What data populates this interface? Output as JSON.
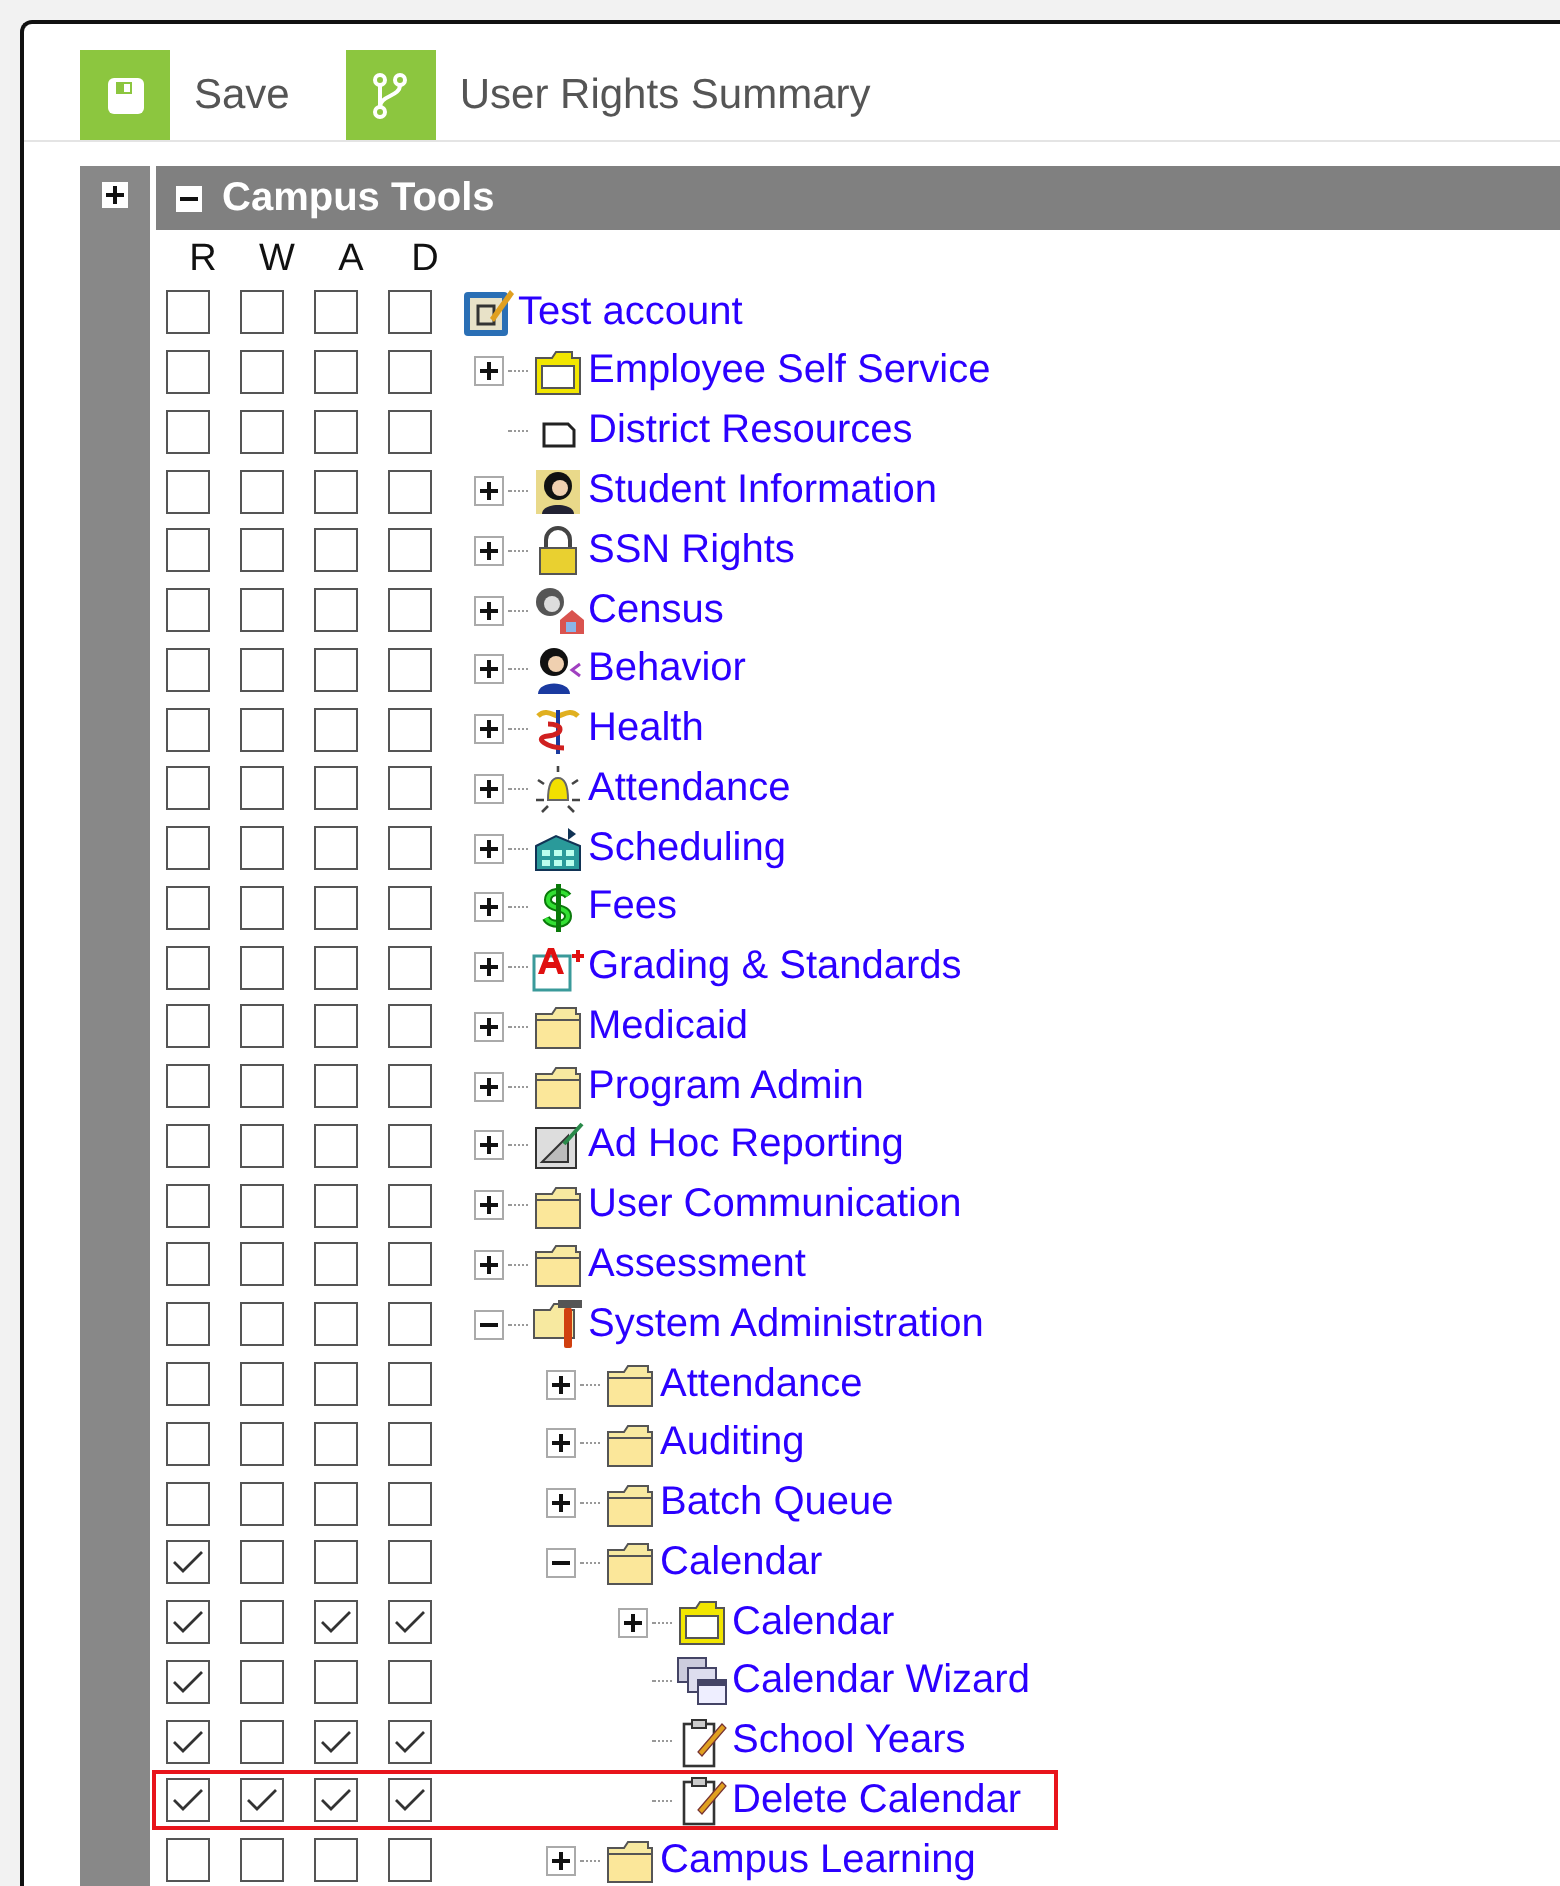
{
  "toolbar": [
    {
      "kind": "save",
      "label": "Save"
    },
    {
      "kind": "summary",
      "label": "User Rights Summary"
    }
  ],
  "sidebar": {
    "expanded": false
  },
  "section": {
    "title": "Campus Tools",
    "expanded": true
  },
  "columns": [
    "R",
    "W",
    "A",
    "D"
  ],
  "tree": {
    "label": "Test account",
    "kind": "account",
    "rights": [
      false,
      false,
      false,
      false
    ],
    "children": [
      {
        "label": "Employee Self Service",
        "kind": "folder-white",
        "rights": [
          false,
          false,
          false,
          false
        ],
        "expanded": false
      },
      {
        "label": "District Resources",
        "kind": "page",
        "rights": [
          false,
          false,
          false,
          false
        ]
      },
      {
        "label": "Student Information",
        "kind": "student",
        "rights": [
          false,
          false,
          false,
          false
        ],
        "expanded": false
      },
      {
        "label": "SSN Rights",
        "kind": "lock",
        "rights": [
          false,
          false,
          false,
          false
        ],
        "expanded": false
      },
      {
        "label": "Census",
        "kind": "census",
        "rights": [
          false,
          false,
          false,
          false
        ],
        "expanded": false
      },
      {
        "label": "Behavior",
        "kind": "behavior",
        "rights": [
          false,
          false,
          false,
          false
        ],
        "expanded": false
      },
      {
        "label": "Health",
        "kind": "health",
        "rights": [
          false,
          false,
          false,
          false
        ],
        "expanded": false
      },
      {
        "label": "Attendance",
        "kind": "bell",
        "rights": [
          false,
          false,
          false,
          false
        ],
        "expanded": false
      },
      {
        "label": "Scheduling",
        "kind": "scheduling",
        "rights": [
          false,
          false,
          false,
          false
        ],
        "expanded": false
      },
      {
        "label": "Fees",
        "kind": "fees",
        "rights": [
          false,
          false,
          false,
          false
        ],
        "expanded": false
      },
      {
        "label": "Grading & Standards",
        "kind": "grading",
        "rights": [
          false,
          false,
          false,
          false
        ],
        "expanded": false
      },
      {
        "label": "Medicaid",
        "kind": "folder",
        "rights": [
          false,
          false,
          false,
          false
        ],
        "expanded": false
      },
      {
        "label": "Program Admin",
        "kind": "folder",
        "rights": [
          false,
          false,
          false,
          false
        ],
        "expanded": false
      },
      {
        "label": "Ad Hoc Reporting",
        "kind": "report",
        "rights": [
          false,
          false,
          false,
          false
        ],
        "expanded": false
      },
      {
        "label": "User Communication",
        "kind": "folder",
        "rights": [
          false,
          false,
          false,
          false
        ],
        "expanded": false
      },
      {
        "label": "Assessment",
        "kind": "folder",
        "rights": [
          false,
          false,
          false,
          false
        ],
        "expanded": false
      },
      {
        "label": "System Administration",
        "kind": "tools",
        "rights": [
          false,
          false,
          false,
          false
        ],
        "expanded": true,
        "children": [
          {
            "label": "Attendance",
            "kind": "folder",
            "rights": [
              false,
              false,
              false,
              false
            ],
            "expanded": false
          },
          {
            "label": "Auditing",
            "kind": "folder",
            "rights": [
              false,
              false,
              false,
              false
            ],
            "expanded": false
          },
          {
            "label": "Batch Queue",
            "kind": "folder",
            "rights": [
              false,
              false,
              false,
              false
            ],
            "expanded": false
          },
          {
            "label": "Calendar",
            "kind": "folder",
            "rights": [
              true,
              false,
              false,
              false
            ],
            "expanded": true,
            "children": [
              {
                "label": "Calendar",
                "kind": "folder-white",
                "rights": [
                  true,
                  false,
                  true,
                  true
                ],
                "expanded": false
              },
              {
                "label": "Calendar Wizard",
                "kind": "wizard",
                "rights": [
                  true,
                  false,
                  false,
                  false
                ]
              },
              {
                "label": "School Years",
                "kind": "notepad",
                "rights": [
                  true,
                  false,
                  true,
                  true
                ]
              },
              {
                "label": "Delete Calendar",
                "kind": "notepad",
                "rights": [
                  true,
                  true,
                  true,
                  true
                ],
                "highlighted": true
              }
            ]
          },
          {
            "label": "Campus Learning",
            "kind": "folder",
            "rights": [
              false,
              false,
              false,
              false
            ],
            "expanded": false
          }
        ]
      }
    ]
  }
}
